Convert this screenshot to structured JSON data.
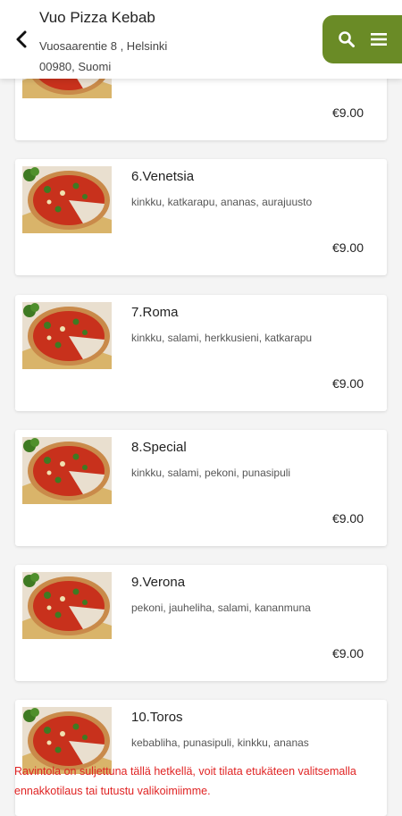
{
  "header": {
    "title": "Vuo Pizza Kebab",
    "address_line1": "Vuosaarentie 8 , Helsinki",
    "address_line2": "00980, Suomi",
    "icons": [
      "back-icon",
      "search-icon",
      "menu-icon"
    ],
    "accent_color": "#6a8b26"
  },
  "items": [
    {
      "name": "",
      "ingredients": "",
      "price": "€9.00"
    },
    {
      "name": "6.Venetsia",
      "ingredients": "kinkku, katkarapu, ananas, aurajuusto",
      "price": "€9.00"
    },
    {
      "name": "7.Roma",
      "ingredients": "kinkku, salami, herkkusieni, katkarapu",
      "price": "€9.00"
    },
    {
      "name": "8.Special",
      "ingredients": "kinkku, salami, pekoni, punasipuli",
      "price": "€9.00"
    },
    {
      "name": "9.Verona",
      "ingredients": "pekoni, jauheliha, salami, kananmuna",
      "price": "€9.00"
    },
    {
      "name": "10.Toros",
      "ingredients": "kebabliha, punasipuli, kinkku, ananas",
      "price": ""
    }
  ],
  "notice": {
    "text": "Ravintola on suljettuna tällä hetkellä, voit tilata etukäteen valitsemalla ennakkotilaus tai tutustu valikoimiimme.",
    "color": "#e02424"
  }
}
